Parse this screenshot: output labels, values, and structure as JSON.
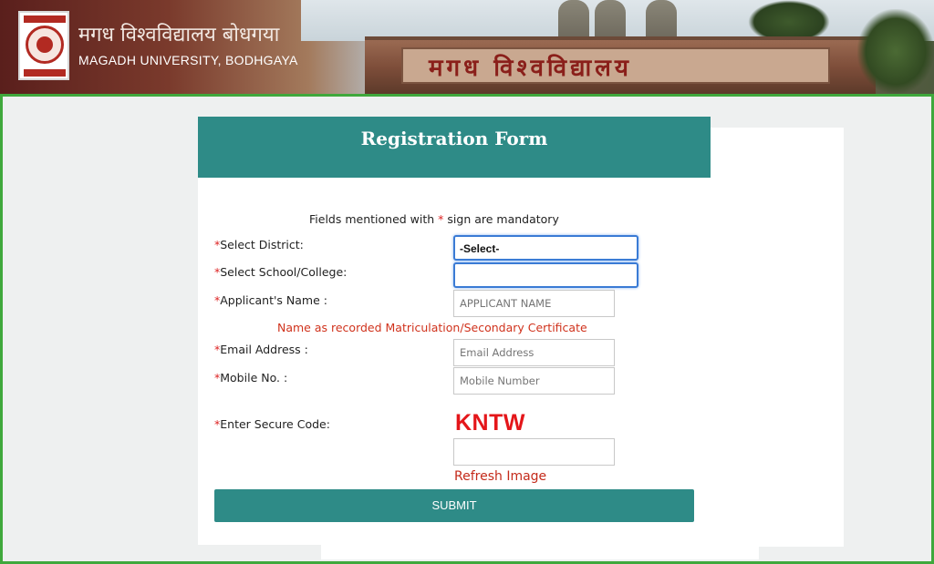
{
  "header": {
    "university_hindi": "मगध विश्वविद्यालय बोधगया",
    "university_english": "MAGADH UNIVERSITY, BODHGAYA",
    "building_sign": "मगध विश्वविद्यालय"
  },
  "form": {
    "title": "Registration Form",
    "mandatory_note_prefix": "Fields mentioned with ",
    "mandatory_star": "*",
    "mandatory_note_suffix": " sign are mandatory",
    "fields": {
      "district": {
        "star": "*",
        "label": "Select District:",
        "value": "-Select-"
      },
      "school": {
        "star": "*",
        "label": "Select School/College:",
        "value": ""
      },
      "name": {
        "star": "*",
        "label": "Applicant's Name :",
        "placeholder": "APPLICANT NAME"
      },
      "email": {
        "star": "*",
        "label": "Email Address :",
        "placeholder": "Email Address"
      },
      "mobile": {
        "star": "*",
        "label": "Mobile No. :",
        "placeholder": "Mobile Number"
      },
      "secure_code": {
        "star": "*",
        "label": "Enter Secure Code:",
        "value": ""
      }
    },
    "name_hint": "Name as recorded Matriculation/Secondary Certificate",
    "captcha_text": "KNTW",
    "refresh_label": "Refresh Image",
    "submit_label": "SUBMIT"
  },
  "colors": {
    "accent": "#2e8b87",
    "frame_border": "#3fa83c",
    "required": "#dd2222",
    "hint": "#d0321c",
    "captcha": "#e4161a"
  }
}
